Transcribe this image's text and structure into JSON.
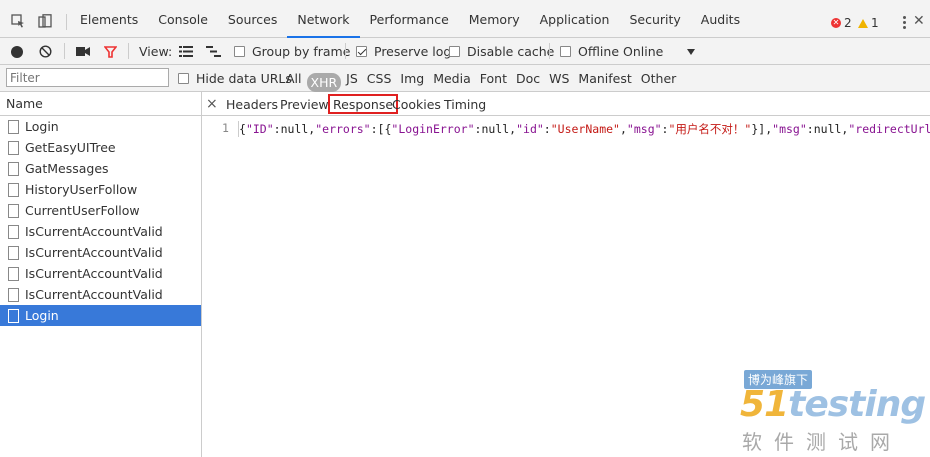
{
  "top_tabs": [
    "Elements",
    "Console",
    "Sources",
    "Network",
    "Performance",
    "Memory",
    "Application",
    "Security",
    "Audits"
  ],
  "active_tab": "Network",
  "status": {
    "errors": "2",
    "warnings": "1"
  },
  "toolbar": {
    "view_label": "View:",
    "group_by_frame": "Group by frame",
    "preserve_log": "Preserve log",
    "disable_cache": "Disable cache",
    "offline": "Offline",
    "throttle": "Online"
  },
  "filter": {
    "placeholder": "Filter",
    "hide_data_urls": "Hide data URLs",
    "types": [
      "All",
      "XHR",
      "JS",
      "CSS",
      "Img",
      "Media",
      "Font",
      "Doc",
      "WS",
      "Manifest",
      "Other"
    ],
    "active_type": "XHR"
  },
  "requests": {
    "header": "Name",
    "items": [
      "Login",
      "GetEasyUITree",
      "GatMessages",
      "HistoryUserFollow",
      "CurrentUserFollow",
      "IsCurrentAccountValid",
      "IsCurrentAccountValid",
      "IsCurrentAccountValid",
      "IsCurrentAccountValid",
      "Login"
    ],
    "selected_index": 9
  },
  "detail": {
    "close": "×",
    "tabs": [
      "Headers",
      "Preview",
      "Response",
      "Cookies",
      "Timing"
    ],
    "highlighted_tab": "Response",
    "line_number": "1",
    "response_text": "{\"ID\":null,\"errors\":[{\"LoginError\":null,\"id\":\"UserName\",\"msg\":\"用户名不对！\"}],\"msg\":null,\"redirectUrl\":nul"
  },
  "watermark": {
    "top": "博为峰旗下",
    "logo_num": "51",
    "logo_text": "testing",
    "bottom": "软件测试网"
  },
  "colors": {
    "selected_row": "#3879d9",
    "highlight_box": "#e02020",
    "active_tab_underline": "#1a73e8"
  }
}
